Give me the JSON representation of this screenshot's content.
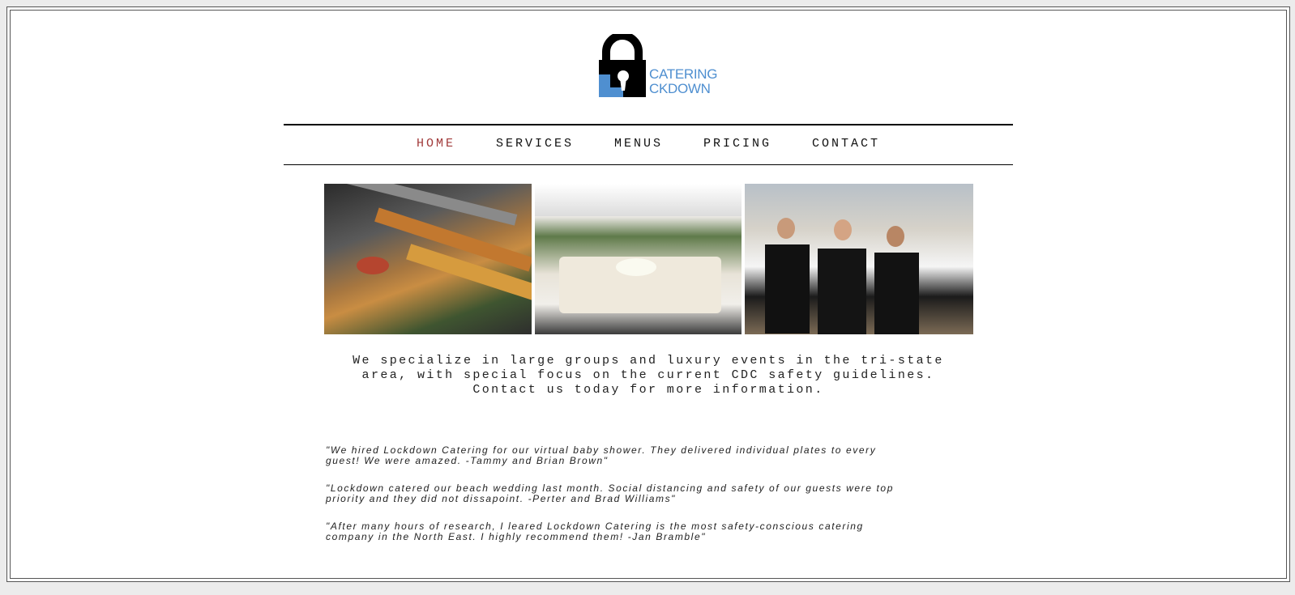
{
  "logo": {
    "name": "lock-icon",
    "line1": "CATERING",
    "line2": "CKDOWN",
    "brand_color": "#4f8fd0"
  },
  "nav": {
    "items": [
      {
        "label": "HOME",
        "active": true
      },
      {
        "label": "SERVICES",
        "active": false
      },
      {
        "label": "MENUS",
        "active": false
      },
      {
        "label": "PRICING",
        "active": false
      },
      {
        "label": "CONTACT",
        "active": false
      }
    ],
    "active_color": "#a13a3a"
  },
  "intro": {
    "line1": "We specialize in large groups and luxury events in the tri-state",
    "line2": "area, with special focus on the current CDC safety guidelines.",
    "line3": "Contact us today for more information."
  },
  "testimonials": [
    {
      "line1": "\"We hired Lockdown Catering for our virtual baby shower. They delivered individual plates to every",
      "line2": "guest! We were amazed. -Tammy and Brian Brown\""
    },
    {
      "line1": "\"Lockdown catered our beach wedding last month. Social distancing and safety of our guests were top",
      "line2": "priority and they did not dissapoint. -Perter and Brad Williams\""
    },
    {
      "line1": "\"After many hours of research, I leared Lockdown Catering is the most safety-conscious catering",
      "line2": "company in the North East. I highly recommend them! -Jan Bramble\""
    }
  ]
}
